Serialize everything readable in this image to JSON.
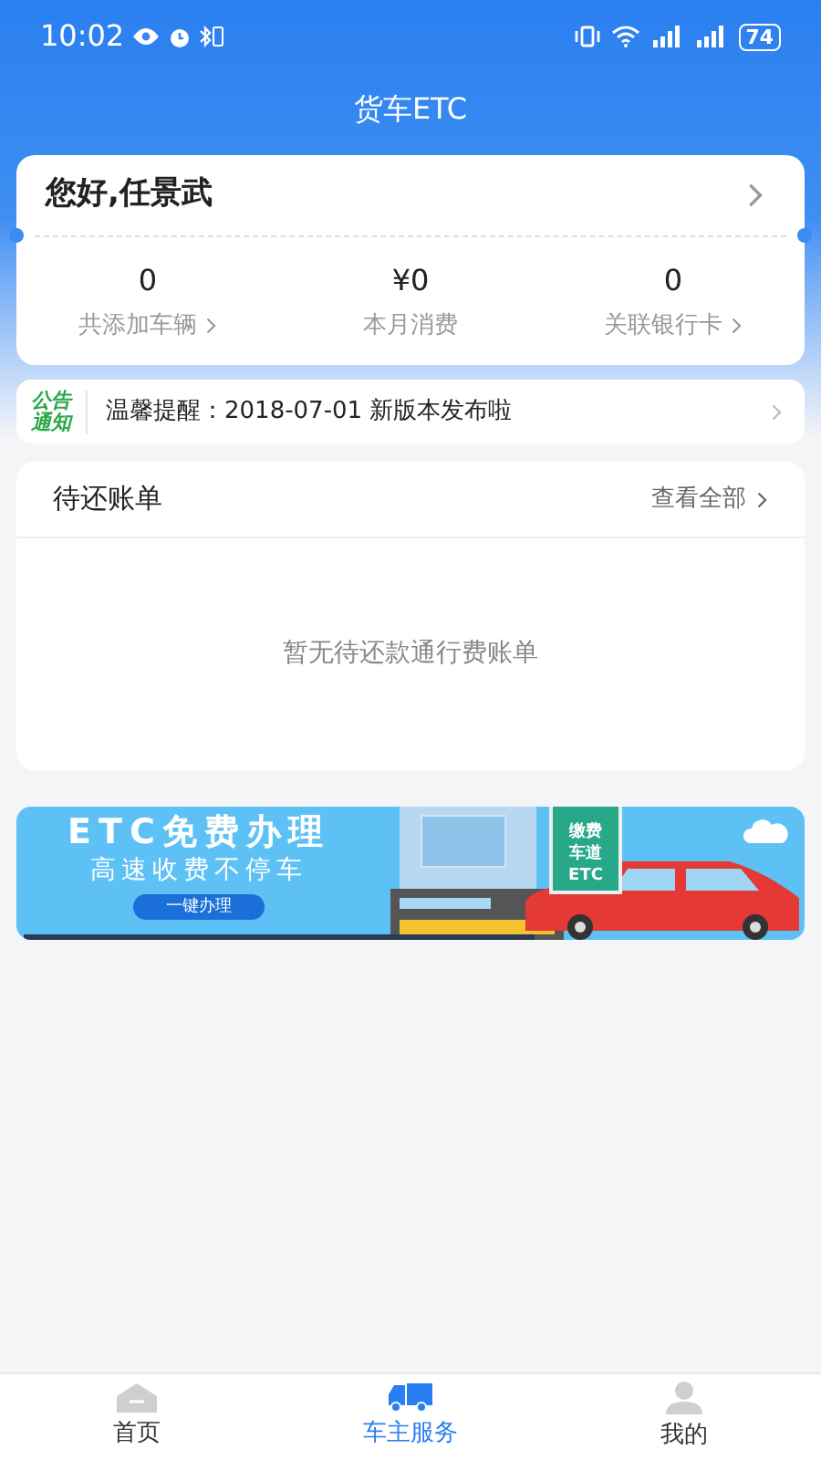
{
  "status_bar": {
    "time": "10:02",
    "battery": "74"
  },
  "header": {
    "title": "货车ETC"
  },
  "account_card": {
    "greeting": "您好,任景武",
    "stats": [
      {
        "value": "0",
        "label": "共添加车辆",
        "has_arrow": true
      },
      {
        "value": "¥0",
        "label": "本月消费",
        "has_arrow": false
      },
      {
        "value": "0",
        "label": "关联银行卡",
        "has_arrow": true
      }
    ]
  },
  "notice": {
    "badge_lines": [
      "公告",
      "通知"
    ],
    "text": "温馨提醒：2018-07-01 新版本发布啦"
  },
  "bills": {
    "title": "待还账单",
    "link": "查看全部",
    "empty_text": "暂无待还款通行费账单"
  },
  "banner": {
    "title": "ETC免费办理",
    "subtitle": "高速收费不停车",
    "button": "一键办理",
    "sign_lines": [
      "缴费",
      "车道",
      "ETC"
    ]
  },
  "tab_bar": [
    {
      "label": "首页",
      "kind": "home",
      "selected": false
    },
    {
      "label": "车主服务",
      "kind": "truck",
      "selected": true
    },
    {
      "label": "我的",
      "kind": "person",
      "selected": false
    }
  ]
}
